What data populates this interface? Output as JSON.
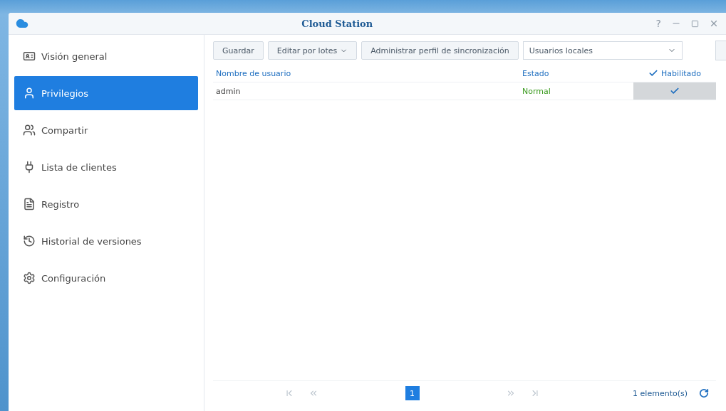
{
  "window": {
    "title": "Cloud Station",
    "help": "?"
  },
  "sidebar": {
    "items": [
      {
        "label": "Visión general",
        "selected": false
      },
      {
        "label": "Privilegios",
        "selected": true
      },
      {
        "label": "Compartir",
        "selected": false
      },
      {
        "label": "Lista de clientes",
        "selected": false
      },
      {
        "label": "Registro",
        "selected": false
      },
      {
        "label": "Historial de versiones",
        "selected": false
      },
      {
        "label": "Configuración",
        "selected": false
      }
    ]
  },
  "toolbar": {
    "buttons": [
      {
        "label": "Guardar",
        "kind": "plain"
      },
      {
        "label": "Editar por lotes",
        "kind": "menu"
      },
      {
        "label": "Administrar perfil de sincronización",
        "kind": "plain"
      }
    ],
    "filter": {
      "value": "Usuarios locales"
    }
  },
  "table": {
    "columns": [
      {
        "label": "Nombre de usuario",
        "kind": "text"
      },
      {
        "label": "Estado",
        "kind": "text"
      },
      {
        "label": "Habilitado",
        "kind": "check",
        "checked": true
      }
    ],
    "rows": [
      {
        "username": "admin",
        "status": "Normal",
        "enabled": true
      }
    ]
  },
  "pager": {
    "pages": [
      {
        "label": "1",
        "selected": true
      }
    ],
    "count": "1 elemento(s)"
  }
}
